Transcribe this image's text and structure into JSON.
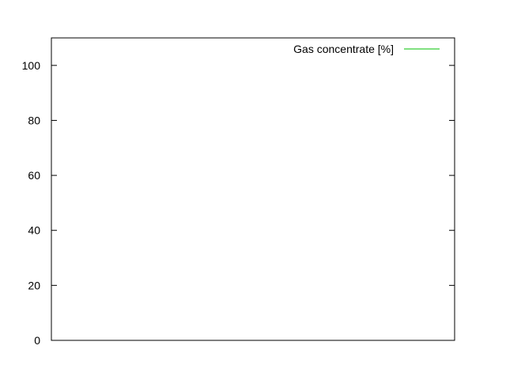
{
  "chart_data": {
    "type": "line",
    "title": "",
    "xlabel": "",
    "ylabel": "",
    "ylim": [
      0,
      110
    ],
    "yticks": [
      0,
      20,
      40,
      60,
      80,
      100
    ],
    "xticks": [],
    "grid": false,
    "legend_position": "top-right",
    "series": [
      {
        "name": "Gas concentrate [%]",
        "color": "#00c000",
        "x": [],
        "y": []
      }
    ]
  }
}
